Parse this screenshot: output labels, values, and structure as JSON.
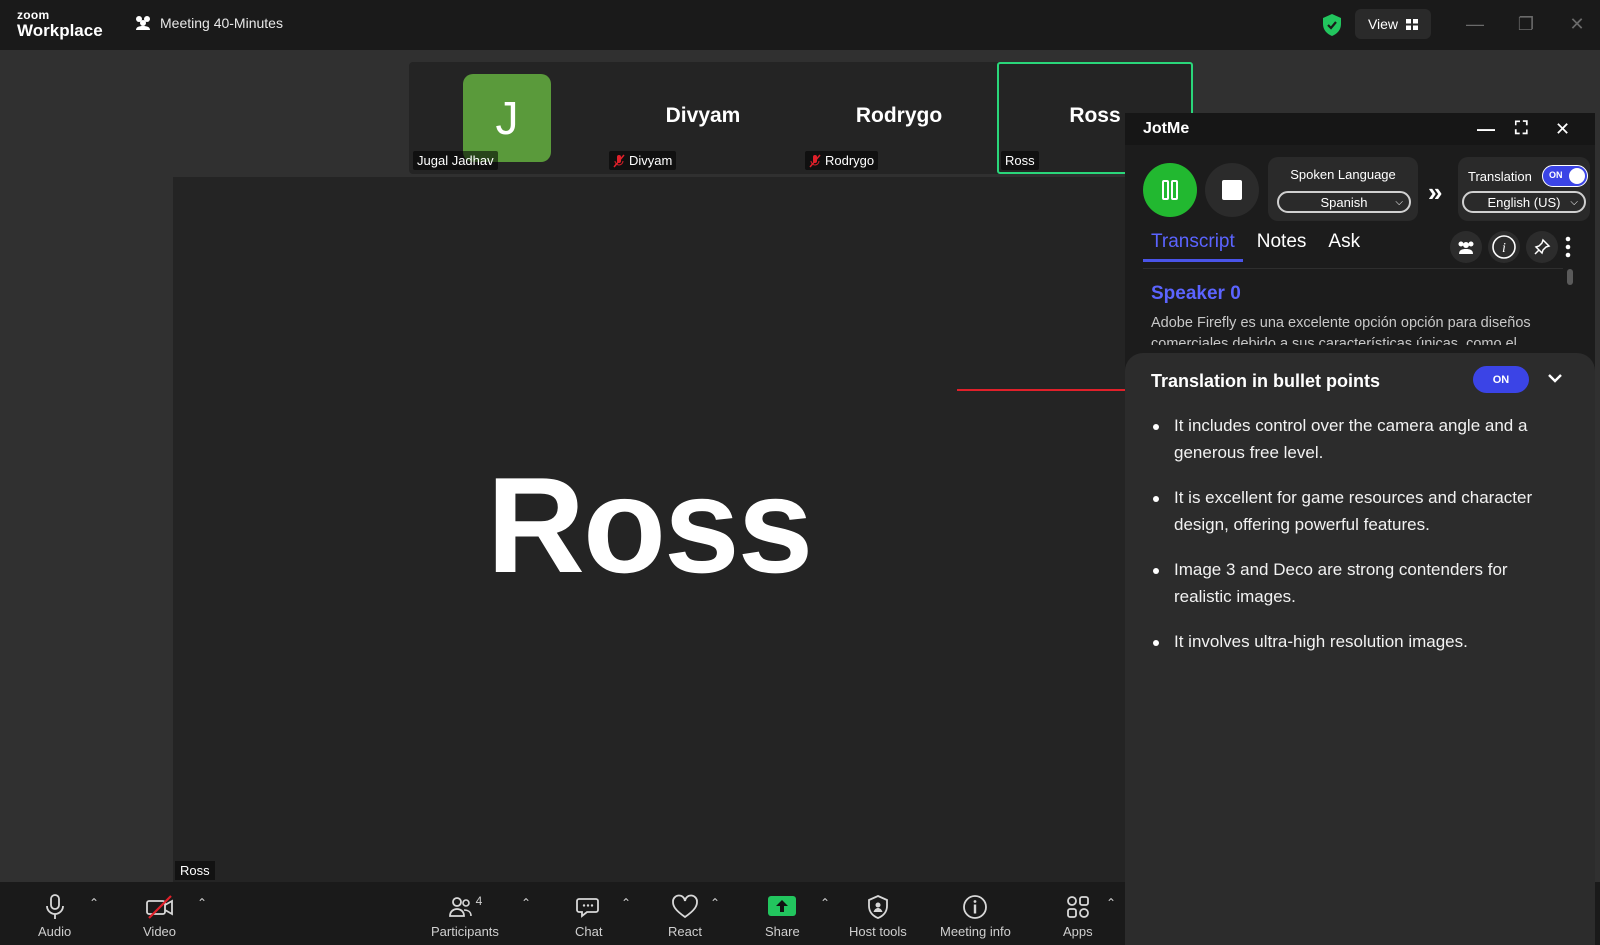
{
  "titlebar": {
    "logo_top": "zoom",
    "logo_bottom": "Workplace",
    "meeting_title": "Meeting 40-Minutes",
    "view_label": "View"
  },
  "participants_strip": [
    {
      "name": "",
      "tag": "Jugal Jadhav",
      "avatar_letter": "J",
      "muted": false
    },
    {
      "name": "Divyam",
      "tag": "Divyam",
      "muted": true
    },
    {
      "name": "Rodrygo",
      "tag": "Rodrygo",
      "muted": true
    },
    {
      "name": "Ross",
      "tag": "Ross",
      "muted": false,
      "active": true
    }
  ],
  "main_video": {
    "speaker_name": "Ross",
    "tag": "Ross"
  },
  "toolbar": {
    "audio": "Audio",
    "video": "Video",
    "participants": "Participants",
    "participants_count": "4",
    "chat": "Chat",
    "react": "React",
    "share": "Share",
    "host_tools": "Host tools",
    "meeting_info": "Meeting info",
    "apps": "Apps"
  },
  "jotme": {
    "title": "JotMe",
    "spoken_language_label": "Spoken Language",
    "spoken_language": "Spanish",
    "translation_label": "Translation",
    "translation_toggle": "ON",
    "translation_language": "English (US)",
    "tabs": [
      "Transcript",
      "Notes",
      "Ask"
    ],
    "active_tab": "Transcript",
    "speaker": "Speaker 0",
    "transcript_snippet": "Adobe Firefly es una excelente opción opción para diseños comerciales debido a sus características únicas, como el",
    "bullets_title": "Translation in bullet points",
    "bullets_toggle": "ON",
    "bullets": [
      "It includes control over the camera angle and a generous free level.",
      "It is excellent for game resources and character design, offering powerful features.",
      "Image 3 and Deco are strong contenders for realistic images.",
      "It involves ultra-high resolution images."
    ]
  },
  "colors": {
    "accent_blue": "#3b44e6",
    "record_green": "#22b830",
    "active_border": "#2ad67a",
    "share_green": "#22c55e",
    "arrow_red": "#e0202a"
  }
}
